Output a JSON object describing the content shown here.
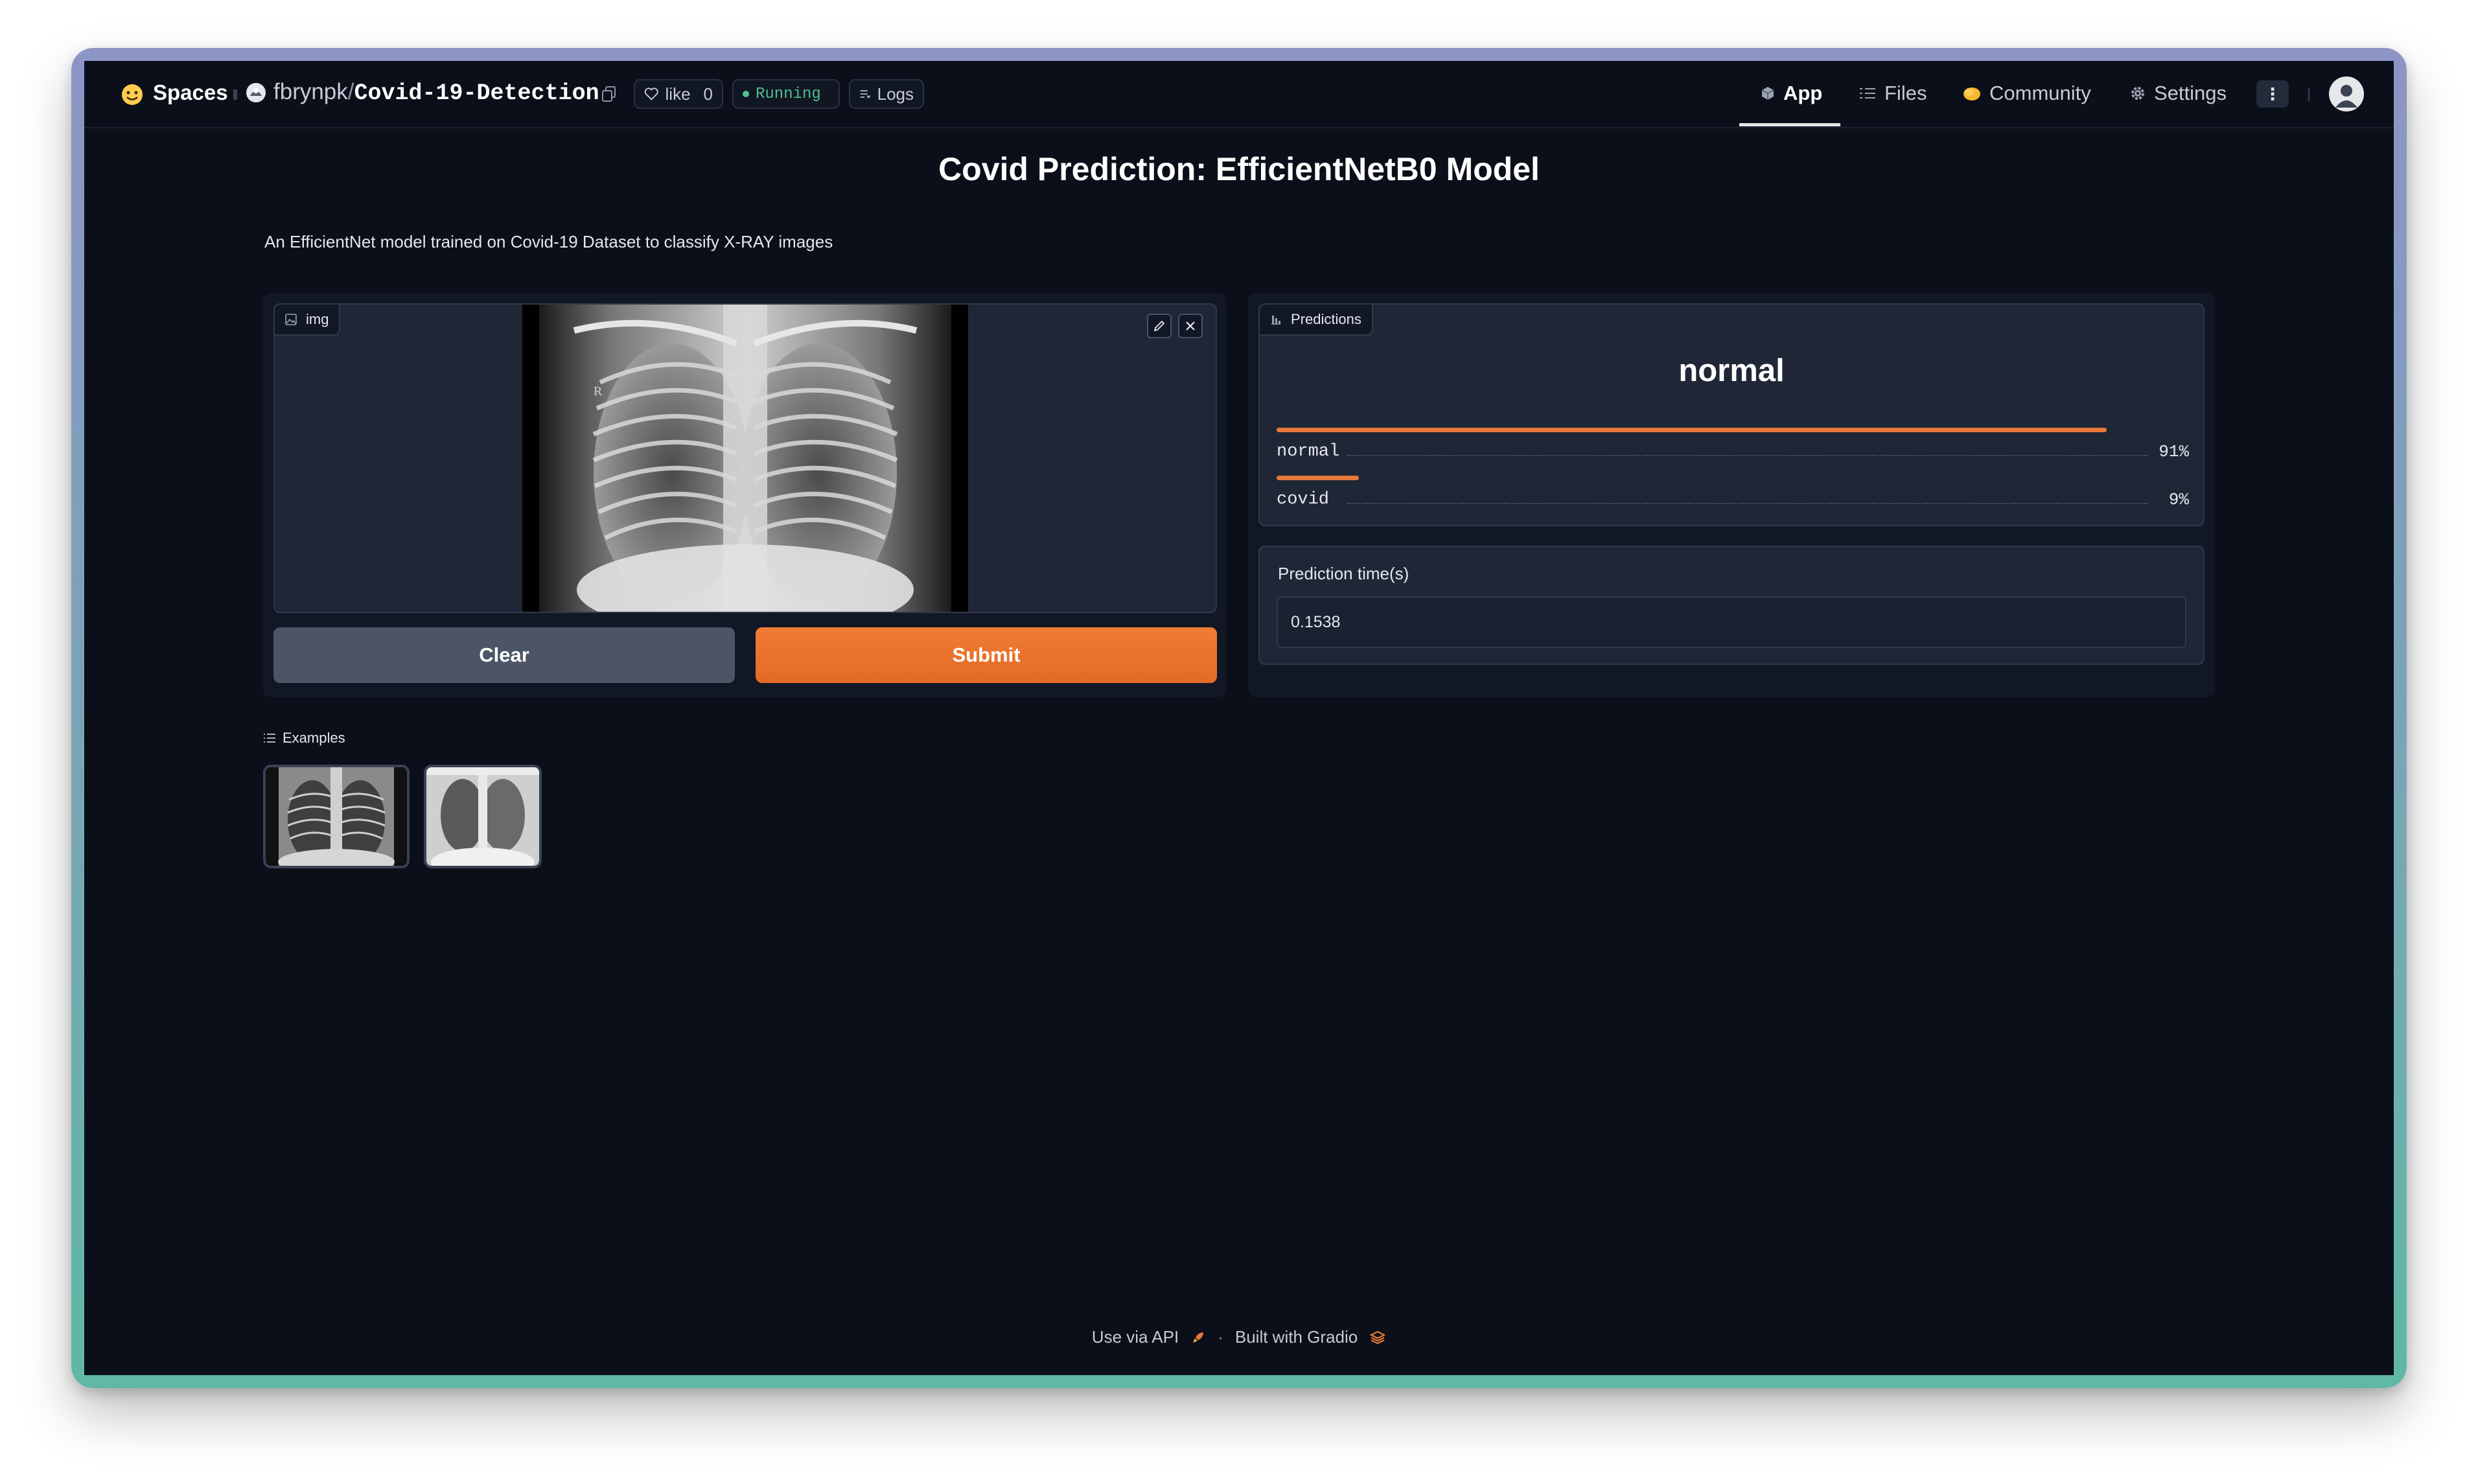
{
  "header": {
    "brand": "Spaces",
    "owner": "fbrynpk",
    "repo_name": "Covid-19-Detection",
    "like_label": "like",
    "like_count": "0",
    "status": "Running",
    "logs_label": "Logs",
    "tabs": [
      {
        "label": "App",
        "icon": "cube-icon",
        "active": true
      },
      {
        "label": "Files",
        "icon": "files-icon",
        "active": false
      },
      {
        "label": "Community",
        "icon": "community-icon",
        "active": false
      },
      {
        "label": "Settings",
        "icon": "gear-icon",
        "active": false
      }
    ]
  },
  "main": {
    "title": "Covid Prediction: EfficientNetB0 Model",
    "description": "An EfficientNet model trained on Covid-19 Dataset to classify X-RAY images"
  },
  "input": {
    "image_label": "img",
    "clear_label": "Clear",
    "submit_label": "Submit"
  },
  "output": {
    "predictions_label": "Predictions",
    "top_label": "normal",
    "confidences": [
      {
        "label": "normal",
        "value": 0.91,
        "percent": "91%"
      },
      {
        "label": "covid",
        "value": 0.09,
        "percent": "9%"
      }
    ],
    "time_label": "Prediction time(s)",
    "time_value": "0.1538"
  },
  "examples": {
    "label": "Examples",
    "count": 2
  },
  "footer": {
    "api_label": "Use via API",
    "separator": "·",
    "built_label": "Built with Gradio"
  },
  "colors": {
    "accent": "#e8773a",
    "background": "#0b0f19",
    "running": "#4fc08d"
  }
}
